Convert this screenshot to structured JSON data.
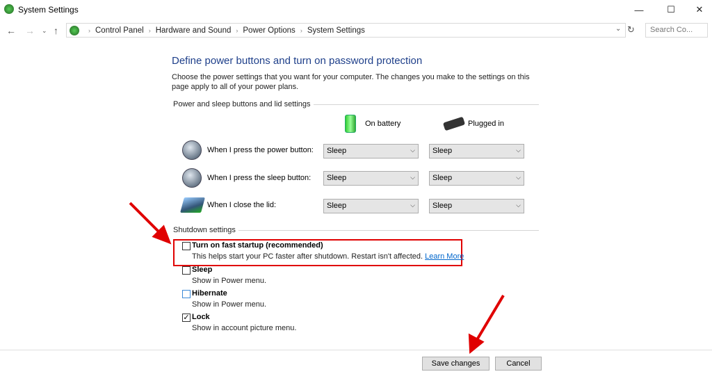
{
  "window": {
    "title": "System Settings",
    "minimize": "—",
    "maximize": "☐",
    "close": "✕"
  },
  "address": {
    "crumbs": [
      "Control Panel",
      "Hardware and Sound",
      "Power Options",
      "System Settings"
    ],
    "search_placeholder": "Search Co..."
  },
  "page": {
    "title": "Define power buttons and turn on password protection",
    "description": "Choose the power settings that you want for your computer. The changes you make to the settings on this page apply to all of your power plans."
  },
  "buttons_group": {
    "label": "Power and sleep buttons and lid settings",
    "col_battery": "On battery",
    "col_plugged": "Plugged in",
    "rows": [
      {
        "label": "When I press the power button:",
        "battery": "Sleep",
        "plugged": "Sleep"
      },
      {
        "label": "When I press the sleep button:",
        "battery": "Sleep",
        "plugged": "Sleep"
      },
      {
        "label": "When I close the lid:",
        "battery": "Sleep",
        "plugged": "Sleep"
      }
    ]
  },
  "shutdown": {
    "label": "Shutdown settings",
    "items": [
      {
        "label": "Turn on fast startup (recommended)",
        "desc": "This helps start your PC faster after shutdown. Restart isn't affected.",
        "link": "Learn More",
        "checked": false
      },
      {
        "label": "Sleep",
        "desc": "Show in Power menu.",
        "checked": false
      },
      {
        "label": "Hibernate",
        "desc": "Show in Power menu.",
        "checked": false
      },
      {
        "label": "Lock",
        "desc": "Show in account picture menu.",
        "checked": true
      }
    ]
  },
  "footer": {
    "save": "Save changes",
    "cancel": "Cancel"
  },
  "colors": {
    "highlight": "#e00000",
    "link": "#0066cc",
    "title": "#1e3f8a"
  }
}
